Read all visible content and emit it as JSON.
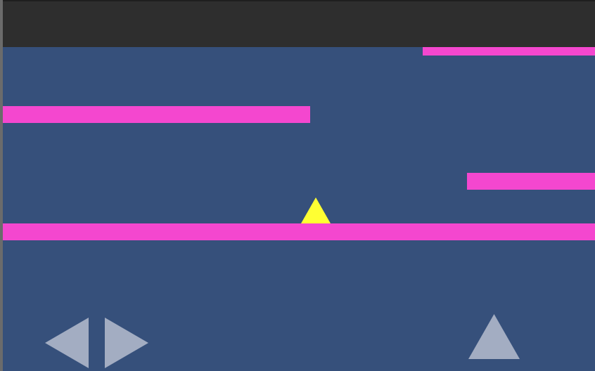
{
  "game": {
    "colors": {
      "background": "#36507b",
      "top_bar": "#2e2e2e",
      "platform": "#f447cf",
      "player": "#ffff33",
      "controls": "#a3adc2"
    },
    "platform_count": 4,
    "player_icon": "triangle-player-icon",
    "controls": [
      {
        "name": "move-left-button",
        "icon": "left-arrow-icon"
      },
      {
        "name": "move-right-button",
        "icon": "right-arrow-icon"
      },
      {
        "name": "jump-button",
        "icon": "up-arrow-icon"
      }
    ]
  }
}
